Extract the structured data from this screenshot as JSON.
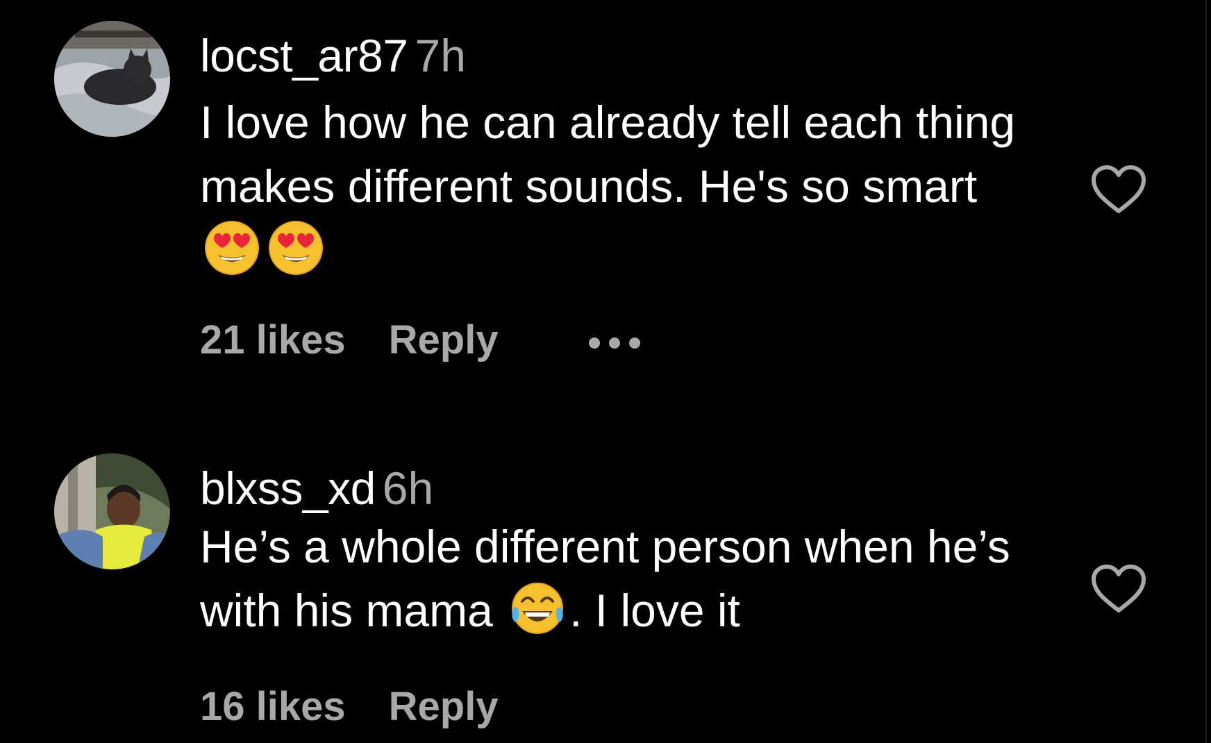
{
  "comments": [
    {
      "username": "locst_ar87",
      "time": "7h",
      "text_main": "I love how he can already tell each thing makes different sounds. He's so smart",
      "text_after": "",
      "emojis": [
        "heart-eyes-emoji",
        "heart-eyes-emoji"
      ],
      "likes": "21 likes",
      "reply": "Reply",
      "more_icon": "ellipsis-icon",
      "like_icon": "heart-outline-icon",
      "avatar_icon": "cat-avatar"
    },
    {
      "username": "blxss_xd",
      "time": "6h",
      "text_main": "He’s a whole different person when he’s with his mama",
      "text_after": ". I love it",
      "emojis": [
        "tears-of-joy-emoji"
      ],
      "likes": "16 likes",
      "reply": "Reply",
      "like_icon": "heart-outline-icon",
      "avatar_icon": "person-avatar"
    }
  ],
  "colors": {
    "background": "#000000",
    "primary_text": "#ffffff",
    "secondary_text": "#a8a8a8"
  }
}
